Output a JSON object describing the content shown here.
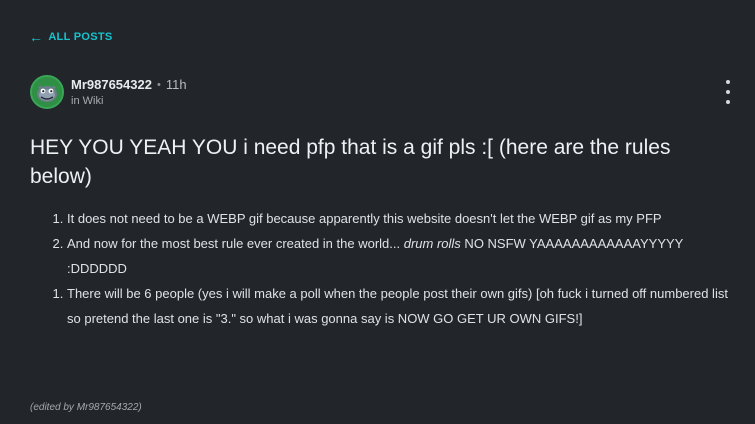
{
  "nav": {
    "back_arrow": "←",
    "back_label": "ALL POSTS"
  },
  "post": {
    "author": "Mr987654322",
    "separator": "•",
    "time": "11h",
    "location": "in Wiki",
    "title": "HEY YOU YEAH YOU i need pfp that is a gif pls :[ (here are the rules below)",
    "list1": [
      {
        "text": "It does not need to be a WEBP gif because apparently this website doesn't let the WEBP gif as my PFP"
      },
      {
        "text_before": "And now for the most best rule ever created in the world... ",
        "text_italic": "drum rolls",
        "text_after": " NO NSFW YAAAAAAAAAAAAYYYYY :DDDDDD"
      }
    ],
    "list2": [
      {
        "text": "There will be 6 people (yes i will make a poll when the people post their own gifs) [oh fuck i turned off numbered list so pretend the last one is \"3.\" so what i was gonna say is NOW GO GET UR OWN GIFS!]"
      }
    ],
    "edited_note": "(edited by Mr987654322)"
  },
  "icons": {
    "back": "arrow-left-icon",
    "menu": "kebab-menu-icon",
    "avatar": "monster-avatar"
  },
  "colors": {
    "background": "#22262b",
    "accent": "#17c3cf",
    "avatar_bg": "#2f8f45"
  }
}
